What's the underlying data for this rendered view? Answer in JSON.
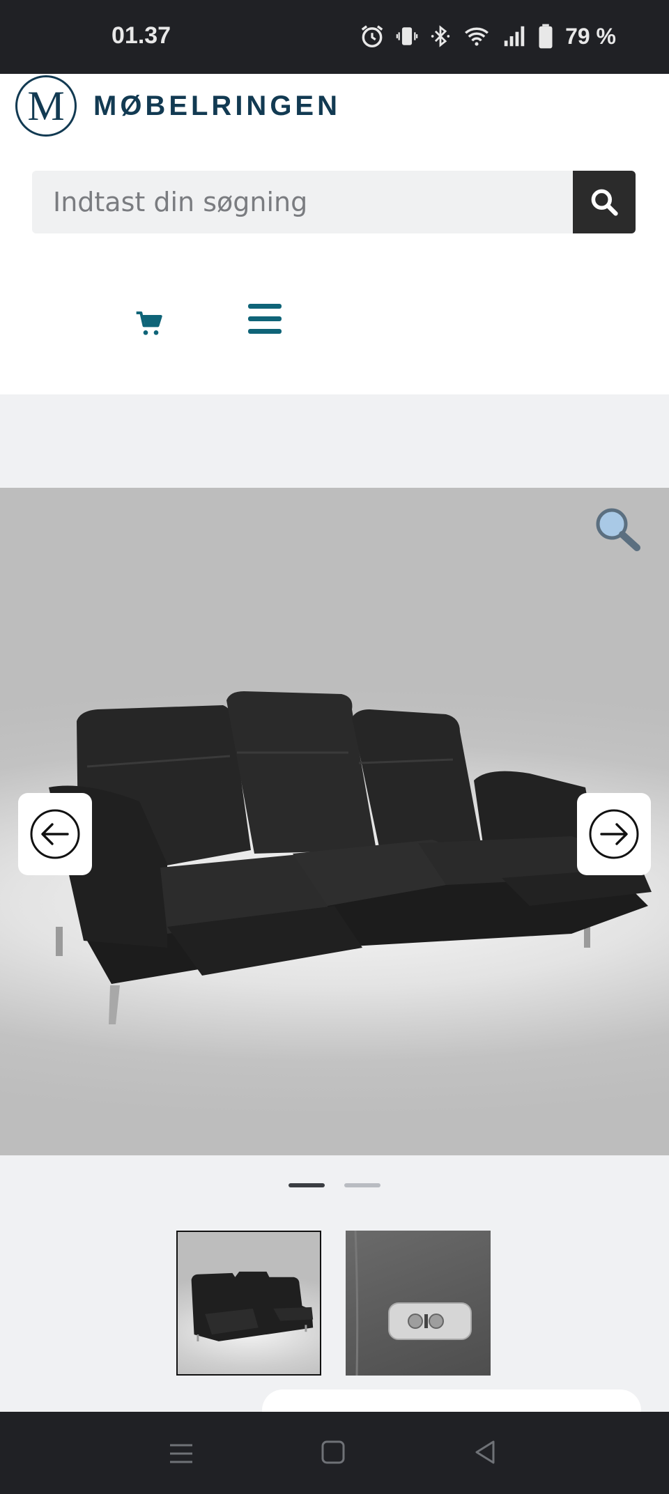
{
  "status_bar": {
    "time": "01.37",
    "battery": "79 %"
  },
  "brand": {
    "logo_letter": "M",
    "name": "MØBELRINGEN",
    "color": "#123a52"
  },
  "search": {
    "placeholder": "Indtast din søgning"
  },
  "header_icons": {
    "cart": "cart-icon",
    "menu": "hamburger-menu-icon",
    "accent": "#0f6478"
  },
  "gallery": {
    "slides_count": 2,
    "active_slide": 1,
    "zoom_icon": "magnifier-icon",
    "prev_icon": "arrow-left-icon",
    "next_icon": "arrow-right-icon"
  },
  "thumbnails": [
    {
      "name": "sofa-thumbnail",
      "selected": true
    },
    {
      "name": "recliner-button-thumbnail",
      "selected": false
    }
  ]
}
